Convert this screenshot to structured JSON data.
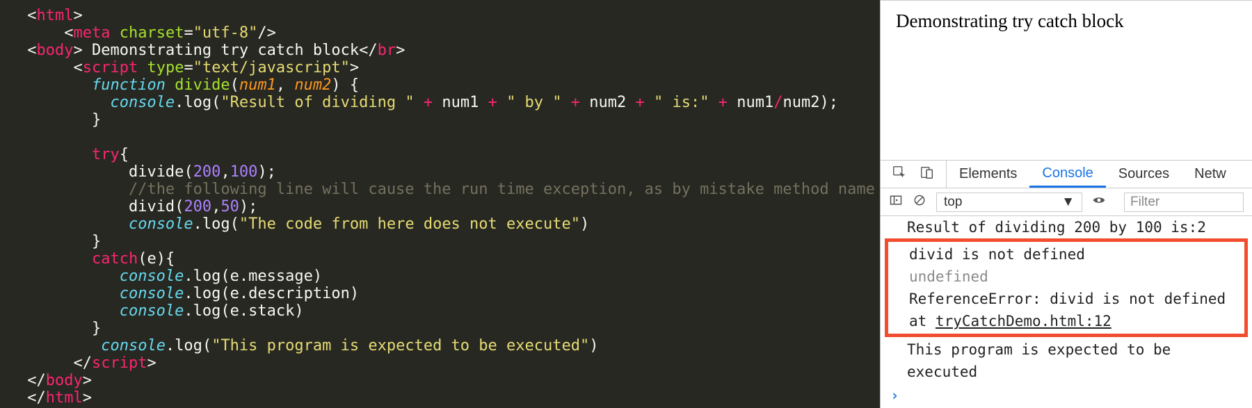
{
  "browser_page": {
    "text": "Demonstrating try catch block"
  },
  "devtools": {
    "tabs": {
      "elements": "Elements",
      "console": "Console",
      "sources": "Sources",
      "network": "Netw"
    },
    "context_selector": "top",
    "filter_placeholder": "Filter"
  },
  "console_output": {
    "line1": "Result of dividing 200 by 100 is:2",
    "highlighted": {
      "msg": "divid is not defined",
      "desc": "undefined",
      "err": "ReferenceError: divid is not defined",
      "at": "at ",
      "loc": "tryCatchDemo.html:12"
    },
    "line_last": "This program is expected to be executed",
    "prompt": "›"
  },
  "code_tokens": {
    "html": "html",
    "meta": "meta",
    "charset": "charset",
    "utf8": "\"utf-8\"",
    "body": "body",
    "body_text": " Demonstrating try catch block",
    "br": "br",
    "script": "script",
    "type": "type",
    "tjs": "\"text/javascript\"",
    "function": "function",
    "divide": "divide",
    "num1": "num1",
    "num2": "num2",
    "console": "console",
    "log": "log",
    "s_res": "\"Result of dividing \"",
    "s_by": "\" by \"",
    "s_is": "\" is:\"",
    "try": "try",
    "call_divide": "divide",
    "n200": "200",
    "n100": "100",
    "n50": "50",
    "comment": "//the following line will cause the run time exception, as by mistake method name is wrong",
    "divid": "divid",
    "s_noexec": "\"The code from here does not execute\"",
    "catch": "catch",
    "e": "e",
    "e_msg": "message",
    "e_desc": "description",
    "e_stack": "stack",
    "s_expect": "\"This program is expected to be executed\""
  }
}
